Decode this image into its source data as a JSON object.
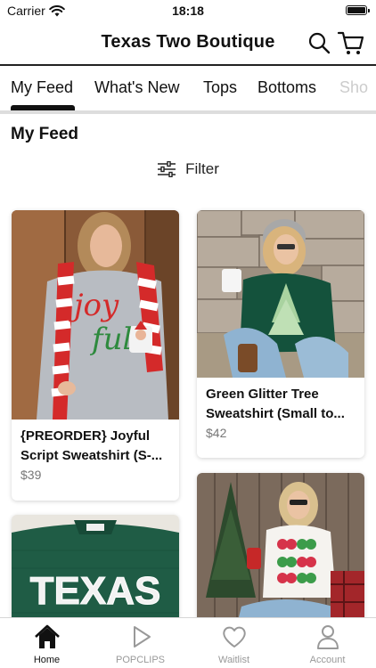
{
  "status_bar": {
    "carrier": "Carrier",
    "time": "18:18"
  },
  "header": {
    "title": "Texas Two Boutique",
    "icons": [
      "search-icon",
      "cart-icon"
    ]
  },
  "tabs": [
    {
      "label": "My Feed",
      "active": true
    },
    {
      "label": "What's New"
    },
    {
      "label": "Tops"
    },
    {
      "label": "Bottoms"
    },
    {
      "label": "Sho"
    }
  ],
  "section": {
    "title": "My Feed",
    "filter_label": "Filter"
  },
  "products": [
    {
      "name": "{PREORDER} Joyful Script Sweatshirt (S-...",
      "price": "$39",
      "graphic_text": [
        "joy",
        "ful"
      ]
    },
    {
      "name": "Green Glitter Tree Sweatshirt (Small to...",
      "price": "$42"
    },
    {
      "name": "",
      "price": "",
      "graphic_text": [
        "TEXAS"
      ]
    },
    {
      "name": "",
      "price": ""
    }
  ],
  "tabbar": [
    {
      "label": "Home",
      "icon": "home-icon",
      "active": true
    },
    {
      "label": "POPCLIPS",
      "icon": "play-icon"
    },
    {
      "label": "Waitlist",
      "icon": "heart-icon"
    },
    {
      "label": "Account",
      "icon": "person-icon"
    }
  ],
  "colors": {
    "text": "#111111",
    "muted": "#777777",
    "tab_inactive": "#999999",
    "divider": "#dddddd"
  }
}
